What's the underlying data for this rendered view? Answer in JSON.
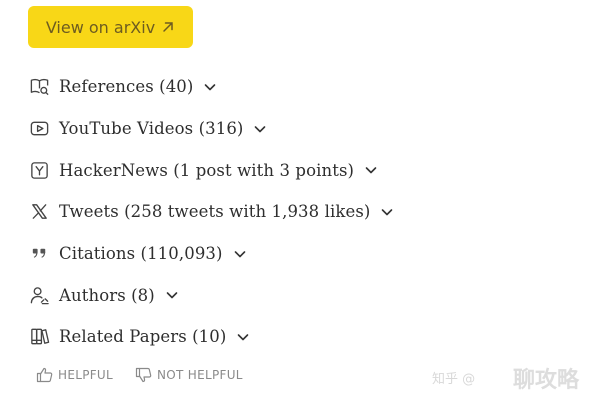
{
  "arxiv_button": {
    "label": "View on arXiv"
  },
  "items": [
    {
      "icon": "references-book-search-icon",
      "label": "References (40)"
    },
    {
      "icon": "youtube-play-icon",
      "label": "YouTube Videos (316)"
    },
    {
      "icon": "hackernews-y-icon",
      "label": "HackerNews (1 post with 3 points)"
    },
    {
      "icon": "x-twitter-icon",
      "label": "Tweets (258 tweets with 1,938 likes)"
    },
    {
      "icon": "quote-icon",
      "label": "Citations (110,093)"
    },
    {
      "icon": "authors-user-icon",
      "label": "Authors (8)"
    },
    {
      "icon": "related-papers-books-icon",
      "label": "Related Papers (10)"
    }
  ],
  "feedback": {
    "helpful": "HELPFUL",
    "not_helpful": "NOT HELPFUL"
  },
  "watermark": {
    "small": "知乎 @",
    "big": "聊攻略"
  }
}
